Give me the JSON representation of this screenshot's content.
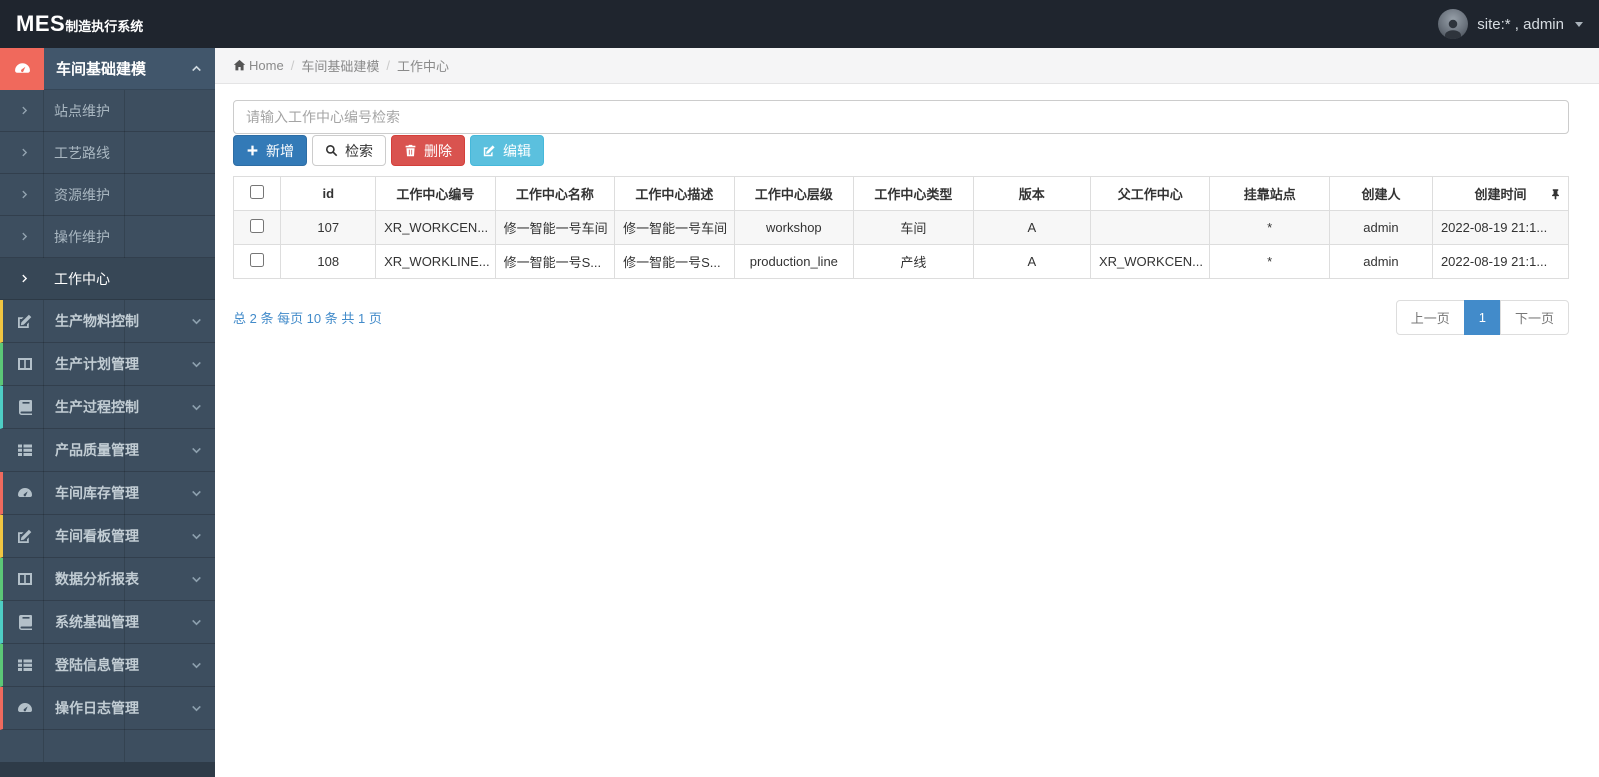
{
  "topbar": {
    "brand_primary": "MES",
    "brand_secondary": "制造执行系统",
    "user_label": "site:* , admin"
  },
  "sidebar": {
    "expanded_group": {
      "key": "workshop-basic-modeling",
      "label": "车间基础建模",
      "icon": "tachometer-icon"
    },
    "sub_items": [
      {
        "key": "station-maintenance",
        "label": "站点维护",
        "active": false
      },
      {
        "key": "process-route",
        "label": "工艺路线",
        "active": false
      },
      {
        "key": "resource-maintenance",
        "label": "资源维护",
        "active": false
      },
      {
        "key": "operation-maintenance",
        "label": "操作维护",
        "active": false
      },
      {
        "key": "work-center",
        "label": "工作中心",
        "active": true
      }
    ],
    "groups": [
      {
        "key": "production-material-control",
        "label": "生产物料控制",
        "icon": "pencil-square-icon",
        "stripe": "#f0c541"
      },
      {
        "key": "production-plan-management",
        "label": "生产计划管理",
        "icon": "columns-icon",
        "stripe": "#5cc777"
      },
      {
        "key": "production-process-control",
        "label": "生产过程控制",
        "icon": "book-icon",
        "stripe": "#4ecdc4"
      },
      {
        "key": "product-quality-management",
        "label": "产品质量管理",
        "icon": "list-icon",
        "stripe": ""
      },
      {
        "key": "workshop-inventory-management",
        "label": "车间库存管理",
        "icon": "tachometer-icon",
        "stripe": "#ef6a5e"
      },
      {
        "key": "workshop-kanban-management",
        "label": "车间看板管理",
        "icon": "pencil-square-icon",
        "stripe": "#f0c541"
      },
      {
        "key": "data-analysis-report",
        "label": "数据分析报表",
        "icon": "columns-icon",
        "stripe": "#5cc777"
      },
      {
        "key": "system-basic-management",
        "label": "系统基础管理",
        "icon": "book-icon",
        "stripe": "#4ecdc4"
      },
      {
        "key": "login-info-management",
        "label": "登陆信息管理",
        "icon": "list-icon",
        "stripe": "#5cc777"
      },
      {
        "key": "operation-log-management",
        "label": "操作日志管理",
        "icon": "tachometer-icon",
        "stripe": "#ef6a5e"
      }
    ]
  },
  "breadcrumb": {
    "home": "Home",
    "crumbs": [
      "车间基础建模",
      "工作中心"
    ]
  },
  "search": {
    "placeholder": "请输入工作中心编号检索"
  },
  "toolbar": {
    "buttons": [
      {
        "key": "add-button",
        "label": "新增",
        "icon": "plus-icon",
        "variant": "primary"
      },
      {
        "key": "search-button",
        "label": "检索",
        "icon": "search-icon",
        "variant": "default"
      },
      {
        "key": "delete-button",
        "label": "删除",
        "icon": "trash-icon",
        "variant": "danger"
      },
      {
        "key": "edit-button",
        "label": "编辑",
        "icon": "edit-icon",
        "variant": "info"
      }
    ]
  },
  "table": {
    "columns": [
      "id",
      "工作中心编号",
      "工作中心名称",
      "工作中心描述",
      "工作中心层级",
      "工作中心类型",
      "版本",
      "父工作中心",
      "挂靠站点",
      "创建人",
      "创建时间"
    ],
    "rows": [
      [
        "107",
        "XR_WORKCEN...",
        "修一智能一号车间",
        "修一智能一号车间",
        "workshop",
        "车间",
        "A",
        "",
        "*",
        "admin",
        "2022-08-19 21:1..."
      ],
      [
        "108",
        "XR_WORKLINE...",
        "修一智能一号S...",
        "修一智能一号S...",
        "production_line",
        "产线",
        "A",
        "XR_WORKCEN...",
        "*",
        "admin",
        "2022-08-19 21:1..."
      ]
    ]
  },
  "pagination": {
    "summary": "总 2 条  每页 10 条  共 1 页",
    "prev_label": "上一页",
    "page": "1",
    "next_label": "下一页"
  },
  "colors": {
    "topbar_bg": "#1f252e",
    "sidebar_bg": "#3d4e5f",
    "brand_icon_block": "#f0695c",
    "accent_blue": "#428bca",
    "primary_blue": "#337ab7",
    "danger_red": "#d9534f",
    "info_cyan": "#5bc0de"
  }
}
